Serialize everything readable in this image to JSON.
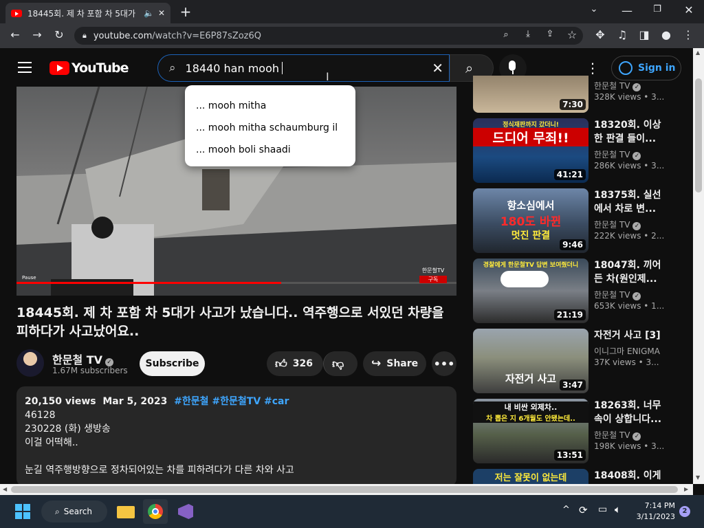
{
  "browser": {
    "tab_title": "18445회. 제 차 포함 차 5대가",
    "address_host": "youtube.com",
    "address_path": "/watch?v=E6P87sZoz6Q"
  },
  "youtube": {
    "logo_text": "YouTube",
    "search_value": "18440 han mooh",
    "signin_label": "Sign in",
    "suggestions": [
      "... mooh mitha",
      "... mooh mitha schaumburg il",
      "... mooh boli shaadi"
    ]
  },
  "video": {
    "title": "18445회. 제 차 포함 차 5대가 사고가 났습니다.. 역주행으로 서있던 차량을 피하다가 사고났어요..",
    "overlay_brand": "한문철TV",
    "overlay_subscribe": "구독",
    "overlay_pause": "Pause",
    "channel_name": "한문철 TV",
    "subscribers": "1.67M subscribers",
    "subscribe_label": "Subscribe",
    "likes": "326",
    "share_label": "Share"
  },
  "description": {
    "views": "20,150 views",
    "date": "Mar 5, 2023",
    "tags": "#한문철 #한문철TV #car",
    "line1": "46128",
    "line2": "230228 (화) 생방송",
    "line3": "이걸 어떡해..",
    "line4": "눈길 역주행방향으로 정차되어있는 차를 피하려다가 다른 차와 사고"
  },
  "recommendations": [
    {
      "title": "",
      "channel": "한문철 TV",
      "meta": "328K views • 3...",
      "duration": "7:30"
    },
    {
      "title": "18320회. 이상한 판결 들이...",
      "channel": "한문철 TV",
      "meta": "286K views • 3...",
      "duration": "41:21",
      "thumb_text": "드디어 무죄!!",
      "thumb_sub": "정식재판까지 갔더니!"
    },
    {
      "title": "18375회. 실선에서 차로 변...",
      "channel": "한문철 TV",
      "meta": "222K views • 2...",
      "duration": "9:46",
      "thumb_text": "항소심에서",
      "thumb_sub": "180도 바뀐",
      "thumb_sub2": "멋진 판결"
    },
    {
      "title": "18047회. 끼어든 차(원인제...",
      "channel": "한문철 TV",
      "meta": "653K views • 1...",
      "duration": "21:19",
      "thumb_text": "경찰에게 한문철TV 답변 보여줬더니"
    },
    {
      "title": "자전거 사고 [3]",
      "channel": "이니그마 ENIGMA",
      "meta": "37K views • 3...",
      "duration": "3:47",
      "thumb_text": "자전거 사고"
    },
    {
      "title": "18263회. 너무 속이 상합니다...",
      "channel": "한문철 TV",
      "meta": "198K views • 3...",
      "duration": "13:51",
      "thumb_text": "내 비싼 외제차..",
      "thumb_sub": "차 뽑은 지 6개월도 안됐는데.."
    },
    {
      "title": "18408회. 이게",
      "thumb_text": "저는 잘못이 없는데"
    }
  ],
  "taskbar": {
    "search_label": "Search",
    "time": "7:14 PM",
    "date": "3/11/2023",
    "notification_count": "2"
  }
}
